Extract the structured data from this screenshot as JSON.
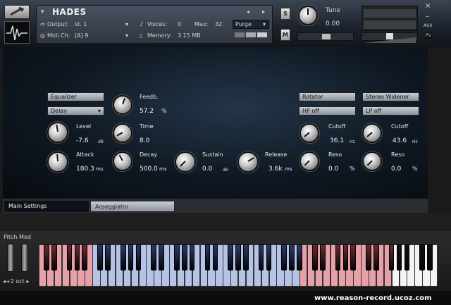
{
  "header": {
    "instrument_name": "HADES",
    "output_label": "Output:",
    "output_value": "st. 1",
    "midi_label": "Midi Ch:",
    "midi_value": "[A]  9",
    "voices_label": "Voices:",
    "voices_value": "0",
    "max_label": "Max:",
    "max_value": "32",
    "memory_label": "Memory:",
    "memory_value": "3.15 MB",
    "purge_label": "Purge",
    "solo_label": "S",
    "mute_label": "M",
    "tune_label": "Tune",
    "tune_value": "0.00",
    "aux_label": "AUX",
    "pv_label": "PV",
    "close_label": "×",
    "minimize_label": "–"
  },
  "main": {
    "equalizer_label": "Equalizer",
    "delay_menu": "Delay",
    "feedb_label": "Feedb.",
    "feedb_value": "57.2",
    "feedb_unit": "%",
    "level_label": "Level",
    "level_value": "-7.6",
    "level_unit": "dB",
    "time_label": "Time",
    "time_value": "8.0",
    "attack_label": "Attack",
    "attack_value": "180.3",
    "attack_unit": "ms",
    "decay_label": "Decay",
    "decay_value": "500.0",
    "decay_unit": "ms",
    "sustain_label": "Sustain",
    "sustain_value": "0.0",
    "sustain_unit": "dB",
    "release_label": "Release",
    "release_value": "3.6k",
    "release_unit": "ms",
    "rotator_label": "Rotator",
    "hp_label": "HP off",
    "hp_cutoff_label": "Cutoff",
    "hp_cutoff_value": "36.1",
    "hp_cutoff_unit": "Hz",
    "hp_reso_label": "Reso",
    "hp_reso_value": "0.0",
    "hp_reso_unit": "%",
    "stereo_label": "Stereo Widener",
    "lp_label": "LP off",
    "lp_cutoff_label": "Cutoff",
    "lp_cutoff_value": "43.6",
    "lp_cutoff_unit": "Hz",
    "lp_reso_label": "Reso",
    "lp_reso_value": "0.0",
    "lp_reso_unit": "%"
  },
  "tabs": [
    "Main Settings",
    "Arpeggiator"
  ],
  "keyboard": {
    "pitch_mod_label": "Pitch Mod",
    "octave_label": "◂+2 oct ▸",
    "colors": {
      "red": "#e8a0a8",
      "blue": "#b4c3e6",
      "white": "#f4f4f4"
    }
  },
  "footer": {
    "watermark": "www.reason-record.ucoz.com"
  }
}
